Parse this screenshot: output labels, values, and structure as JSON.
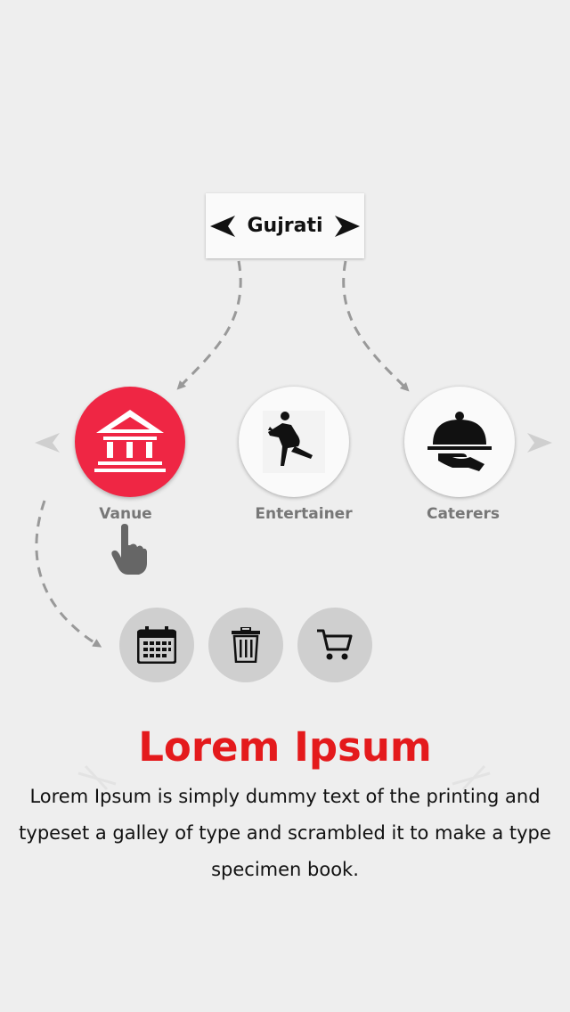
{
  "selector": {
    "label": "Gujrati",
    "prev_icon": "arrow-left-icon",
    "next_icon": "arrow-right-icon"
  },
  "categories": [
    {
      "label": "Vanue",
      "icon": "venue-building-icon",
      "active": true
    },
    {
      "label": "Entertainer",
      "icon": "dancer-icon",
      "active": false
    },
    {
      "label": "Caterers",
      "icon": "food-cloche-icon",
      "active": false
    }
  ],
  "actions": [
    {
      "icon": "calendar-icon"
    },
    {
      "icon": "trash-icon"
    },
    {
      "icon": "cart-icon"
    }
  ],
  "content": {
    "title": "Lorem Ipsum",
    "body": "Lorem Ipsum is simply dummy text of the printing and typeset a galley of type and scrambled it to make a type specimen book."
  },
  "colors": {
    "accent": "#e41a1c",
    "active_circle": "#ef2644",
    "background": "#eeeeee",
    "label_gray": "#777777"
  }
}
